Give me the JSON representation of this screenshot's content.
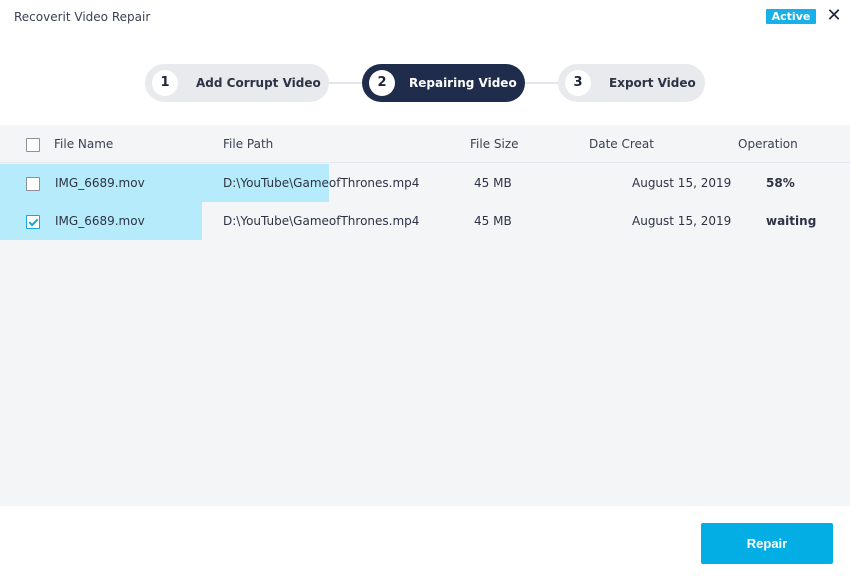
{
  "window": {
    "title": "Recoverit Video Repair",
    "badge": "Active",
    "close_icon": "close-icon"
  },
  "stepper": {
    "steps": [
      {
        "number": "1",
        "label": "Add Corrupt Video",
        "state": "inactive"
      },
      {
        "number": "2",
        "label": "Repairing Video",
        "state": "active"
      },
      {
        "number": "3",
        "label": "Export Video",
        "state": "inactive"
      }
    ]
  },
  "table": {
    "columns": [
      "File Name",
      "File Path",
      "File Size",
      "Date Creat",
      "Operation"
    ],
    "select_all_checked": false,
    "rows": [
      {
        "checked": false,
        "name": "IMG_6689.mov",
        "path": "D:\\YouTube\\GameofThrones.mp4",
        "size": "45 MB",
        "date": "August 15, 2019",
        "operation": "58%",
        "progress_percent": 58
      },
      {
        "checked": true,
        "name": "IMG_6689.mov",
        "path": "D:\\YouTube\\GameofThrones.mp4",
        "size": "45 MB",
        "date": "August 15, 2019",
        "operation": "waiting",
        "progress_percent": 24
      }
    ]
  },
  "footer": {
    "repair_label": "Repair"
  },
  "colors": {
    "accent": "#03aee4",
    "active_step": "#1f2c4b",
    "progress_fill": "#b6ebfb"
  }
}
